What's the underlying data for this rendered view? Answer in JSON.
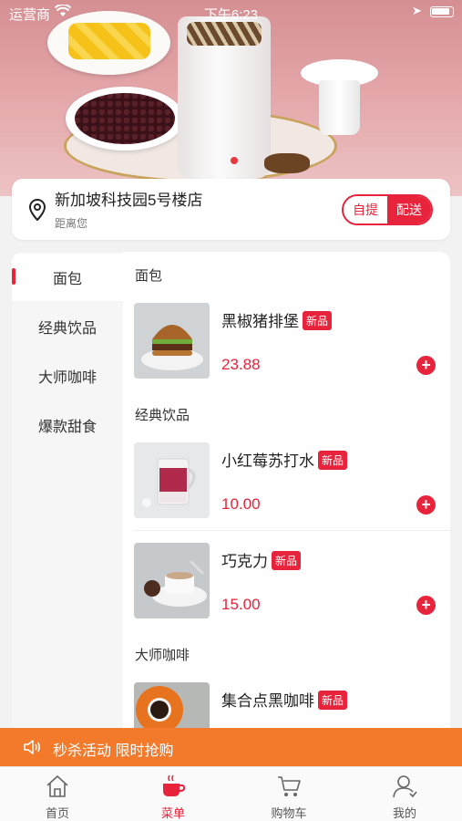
{
  "status_bar": {
    "carrier": "运营商",
    "time": "下午6:23"
  },
  "store": {
    "name": "新加坡科技园5号楼店",
    "distance_label": "距离您",
    "mode_pickup": "自提",
    "mode_delivery": "配送",
    "selected_mode": "配送"
  },
  "sidebar": {
    "items": [
      {
        "label": "面包",
        "active": true
      },
      {
        "label": "经典饮品",
        "active": false
      },
      {
        "label": "大师咖啡",
        "active": false
      },
      {
        "label": "爆款甜食",
        "active": false
      }
    ]
  },
  "menu": {
    "sections": [
      {
        "title": "面包",
        "items": [
          {
            "name": "黑椒猪排堡",
            "badge": "新品",
            "price": "23.88",
            "image": "burger"
          }
        ]
      },
      {
        "title": "经典饮品",
        "items": [
          {
            "name": "小红莓苏打水",
            "badge": "新品",
            "price": "10.00",
            "image": "cranberry-soda"
          },
          {
            "name": "巧克力",
            "badge": "新品",
            "price": "15.00",
            "image": "hot-chocolate"
          }
        ]
      },
      {
        "title": "大师咖啡",
        "items": [
          {
            "name": "集合点黑咖啡",
            "badge": "新品",
            "image": "black-coffee"
          }
        ]
      }
    ],
    "add_icon": "plus-circle-icon"
  },
  "promo": {
    "text": "秒杀活动 限时抢购",
    "icon": "speaker-icon"
  },
  "tabbar": {
    "tabs": [
      {
        "label": "首页",
        "icon": "home-icon",
        "active": false
      },
      {
        "label": "菜单",
        "icon": "cup-icon",
        "active": true
      },
      {
        "label": "购物车",
        "icon": "cart-icon",
        "active": false
      },
      {
        "label": "我的",
        "icon": "user-icon",
        "active": false
      }
    ]
  },
  "colors": {
    "accent": "#e8233c",
    "promo_bg": "#f37a2b"
  }
}
